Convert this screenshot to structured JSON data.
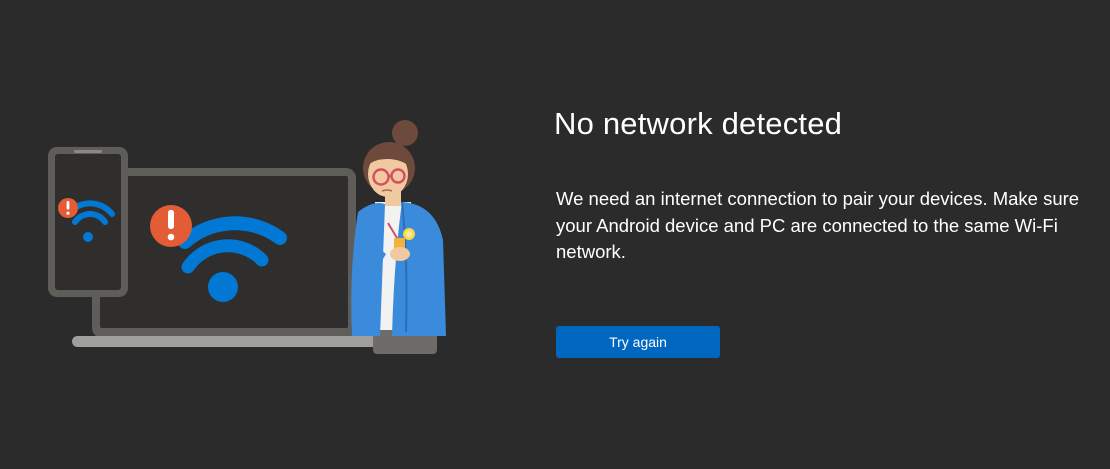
{
  "dialog": {
    "title": "No network detected",
    "message": "We need an internet connection to pair your devices. Make sure your Android device and PC are connected to the same Wi-Fi network.",
    "try_again_label": "Try again"
  },
  "illustration": {
    "icons": [
      "phone-icon",
      "laptop-icon",
      "wifi-icon",
      "warning-icon",
      "person-figure"
    ],
    "colors": {
      "wifi": "#0078d4",
      "warning": "#e35c36",
      "device_frame": "#5f5d5a",
      "device_screen": "#2f2e2c",
      "jacket": "#3a8bdc"
    }
  }
}
